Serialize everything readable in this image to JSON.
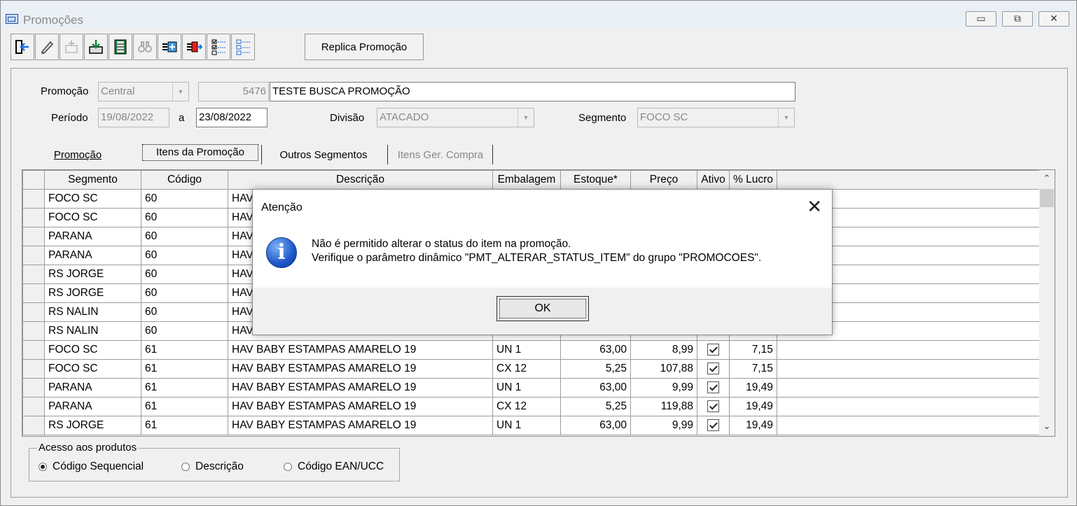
{
  "window": {
    "title": "Promoções",
    "minimize": "▭",
    "restore": "⧉",
    "close": "✕"
  },
  "toolbar": {
    "icons": [
      "exit-icon",
      "eraser-icon",
      "copy-icon",
      "save-icon",
      "calculator-icon",
      "binoculars-icon",
      "add-item-icon",
      "export-icon",
      "checklist-select-icon",
      "checklist-unselect-icon"
    ],
    "replica_label": "Replica Promoção"
  },
  "form": {
    "promocao_label": "Promoção",
    "promocao_tipo": "Central",
    "promocao_codigo": "5476",
    "promocao_nome": "TESTE BUSCA PROMOÇÃO",
    "periodo_label": "Período",
    "periodo_inicio": "19/08/2022",
    "periodo_sep": "a",
    "periodo_fim": "23/08/2022",
    "divisao_label": "Divisão",
    "divisao_value": "ATACADO",
    "segmento_label": "Segmento",
    "segmento_value": "FOCO SC"
  },
  "tabs": [
    {
      "label": "Promoção"
    },
    {
      "label": "Itens da Promoção"
    },
    {
      "label": "Outros Segmentos"
    },
    {
      "label": "Itens Ger. Compra"
    }
  ],
  "grid": {
    "columns": [
      "Segmento",
      "Código",
      "Descrição",
      "Embalagem",
      "Estoque*",
      "Preço",
      "Ativo",
      "% Lucro"
    ],
    "rows": [
      {
        "segmento": "FOCO SC",
        "codigo": "60",
        "descricao": "HAV",
        "embalagem": "",
        "estoque": "",
        "preco": "",
        "ativo": false,
        "lucro": ""
      },
      {
        "segmento": "FOCO SC",
        "codigo": "60",
        "descricao": "HAV",
        "embalagem": "",
        "estoque": "",
        "preco": "",
        "ativo": false,
        "lucro": ""
      },
      {
        "segmento": "PARANA",
        "codigo": "60",
        "descricao": "HAV",
        "embalagem": "",
        "estoque": "",
        "preco": "",
        "ativo": false,
        "lucro": ""
      },
      {
        "segmento": "PARANA",
        "codigo": "60",
        "descricao": "HAV",
        "embalagem": "",
        "estoque": "",
        "preco": "",
        "ativo": false,
        "lucro": ""
      },
      {
        "segmento": "RS JORGE",
        "codigo": "60",
        "descricao": "HAV",
        "embalagem": "",
        "estoque": "",
        "preco": "",
        "ativo": false,
        "lucro": ""
      },
      {
        "segmento": "RS JORGE",
        "codigo": "60",
        "descricao": "HAV",
        "embalagem": "",
        "estoque": "",
        "preco": "",
        "ativo": false,
        "lucro": ""
      },
      {
        "segmento": "RS NALIN",
        "codigo": "60",
        "descricao": "HAV",
        "embalagem": "",
        "estoque": "",
        "preco": "",
        "ativo": false,
        "lucro": ""
      },
      {
        "segmento": "RS NALIN",
        "codigo": "60",
        "descricao": "HAV",
        "embalagem": "",
        "estoque": "",
        "preco": "",
        "ativo": false,
        "lucro": ""
      },
      {
        "segmento": "FOCO SC",
        "codigo": "61",
        "descricao": "HAV BABY ESTAMPAS AMARELO 19",
        "embalagem": "UN  1",
        "estoque": "63,00",
        "preco": "8,99",
        "ativo": true,
        "lucro": "7,15"
      },
      {
        "segmento": "FOCO SC",
        "codigo": "61",
        "descricao": "HAV BABY ESTAMPAS AMARELO 19",
        "embalagem": "CX  12",
        "estoque": "5,25",
        "preco": "107,88",
        "ativo": true,
        "lucro": "7,15"
      },
      {
        "segmento": "PARANA",
        "codigo": "61",
        "descricao": "HAV BABY ESTAMPAS AMARELO 19",
        "embalagem": "UN  1",
        "estoque": "63,00",
        "preco": "9,99",
        "ativo": true,
        "lucro": "19,49"
      },
      {
        "segmento": "PARANA",
        "codigo": "61",
        "descricao": "HAV BABY ESTAMPAS AMARELO 19",
        "embalagem": "CX  12",
        "estoque": "5,25",
        "preco": "119,88",
        "ativo": true,
        "lucro": "19,49"
      },
      {
        "segmento": "RS JORGE",
        "codigo": "61",
        "descricao": "HAV BABY ESTAMPAS AMARELO 19",
        "embalagem": "UN  1",
        "estoque": "63,00",
        "preco": "9,99",
        "ativo": true,
        "lucro": "19,49"
      }
    ]
  },
  "acesso": {
    "title": "Acesso aos produtos",
    "options": [
      "Código Sequencial",
      "Descrição",
      "Código EAN/UCC"
    ],
    "selected": "Código Sequencial"
  },
  "dialog": {
    "title": "Atenção",
    "line1": "Não é permitido alterar o status do item na promoção.",
    "line2": "Verifique o parâmetro dinâmico \"PMT_ALTERAR_STATUS_ITEM\" do grupo \"PROMOCOES\".",
    "ok_label": "OK",
    "close_glyph": "✕",
    "icon": "i"
  }
}
